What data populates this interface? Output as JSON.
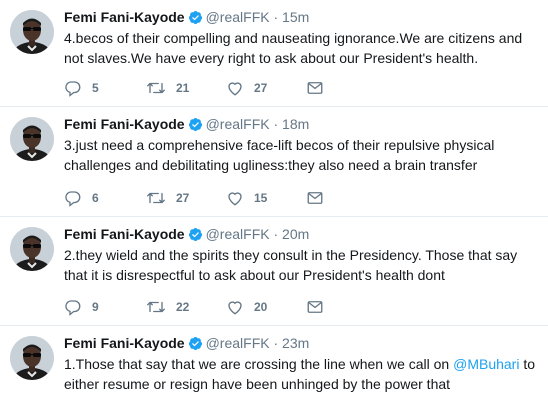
{
  "tweets": [
    {
      "name": "Femi Fani-Kayode",
      "handle": "@realFFK",
      "dot": "·",
      "time": "15m",
      "text_before": "4.becos of their compelling and nauseating ignorance.We are citizens and not slaves.We have every right to ask about our President's health.",
      "mention": "",
      "text_after": "",
      "replies": "5",
      "retweets": "21",
      "likes": "27"
    },
    {
      "name": "Femi Fani-Kayode",
      "handle": "@realFFK",
      "dot": "·",
      "time": "18m",
      "text_before": "3.just need a comprehensive face-lift becos of their repulsive physical challenges and debilitating ugliness:they also need a brain transfer",
      "mention": "",
      "text_after": "",
      "replies": "6",
      "retweets": "27",
      "likes": "15"
    },
    {
      "name": "Femi Fani-Kayode",
      "handle": "@realFFK",
      "dot": "·",
      "time": "20m",
      "text_before": "2.they wield and the spirits they consult in the Presidency. Those that say that it is disrespectful to ask about our President's health dont",
      "mention": "",
      "text_after": "",
      "replies": "9",
      "retweets": "22",
      "likes": "20"
    },
    {
      "name": "Femi Fani-Kayode",
      "handle": "@realFFK",
      "dot": "·",
      "time": "23m",
      "text_before": "1.Those that say that we are crossing the line when we call on ",
      "mention": "@MBuhari",
      "text_after": " to either resume or resign have been unhinged by the power that",
      "replies": "",
      "retweets": "",
      "likes": ""
    }
  ],
  "colors": {
    "text": "#14171a",
    "muted": "#657786",
    "link": "#1da1f2",
    "divider": "#e6ecf0",
    "verified": "#1da1f2"
  },
  "icons": {
    "verified": "verified-badge-icon",
    "reply": "reply-icon",
    "retweet": "retweet-icon",
    "like": "heart-icon",
    "dm": "envelope-icon"
  }
}
